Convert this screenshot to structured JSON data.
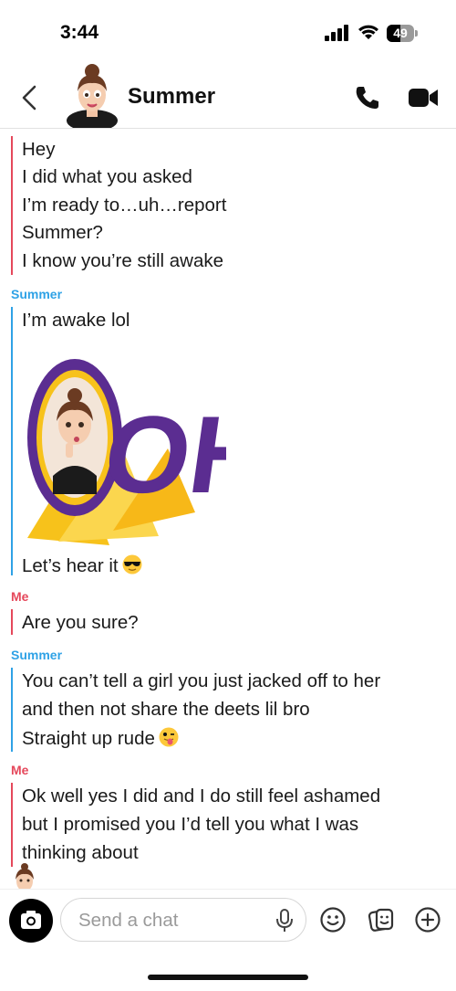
{
  "status_bar": {
    "time": "3:44",
    "battery": "49"
  },
  "header": {
    "title": "Summer"
  },
  "labels": {
    "summer": "Summer",
    "me": "Me"
  },
  "messages": {
    "g1": [
      "Hey",
      "I did what you asked",
      "I’m ready to…uh…report",
      "Summer?",
      "I know you’re still awake"
    ],
    "g2a": "I’m awake lol",
    "g2b": "Let’s hear it",
    "g3": "Are you sure?",
    "g4": [
      "You can’t tell a girl you just jacked off to her",
      "and then not share the deets lil bro",
      "Straight up rude"
    ],
    "g5": [
      "Ok well yes I did and I do still feel ashamed",
      "but I promised you I’d tell you what I was",
      "thinking about"
    ]
  },
  "sticker": {
    "text": "OH?"
  },
  "composer": {
    "placeholder": "Send a chat"
  },
  "icons": {
    "back": "chevron-left-icon",
    "call": "phone-icon",
    "video": "video-camera-icon",
    "camera": "camera-icon",
    "mic": "microphone-icon",
    "emoji": "smiley-icon",
    "sticker": "sticker-icon",
    "plus": "plus-circle-icon"
  },
  "colors": {
    "me": "#e5485b",
    "summer": "#2fa2e6",
    "sticker_purple": "#5b2d91",
    "sticker_yellow": "#f7c21b"
  }
}
